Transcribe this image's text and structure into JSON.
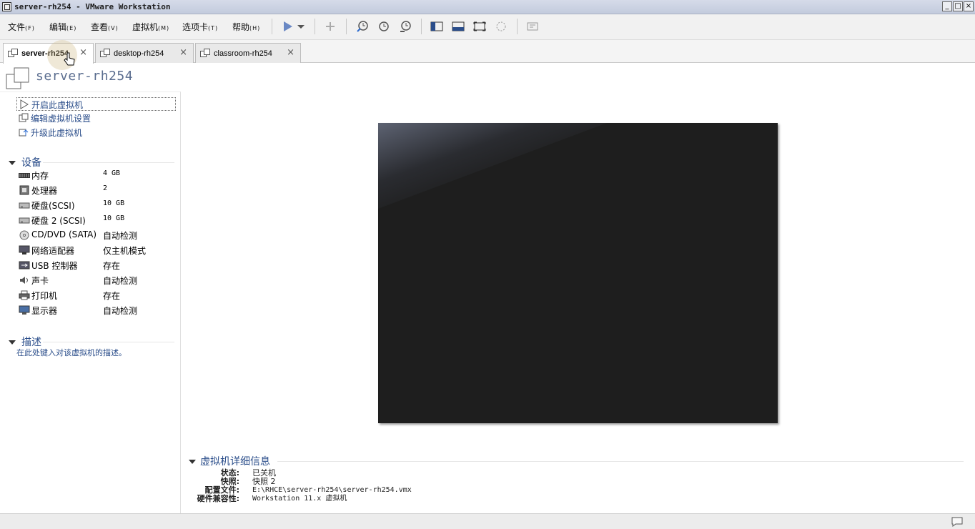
{
  "window": {
    "title": "server-rh254 - VMware Workstation",
    "controls": [
      "_",
      "□",
      "×"
    ]
  },
  "menu": [
    {
      "label": "文件",
      "key": "(F)"
    },
    {
      "label": "编辑",
      "key": "(E)"
    },
    {
      "label": "查看",
      "key": "(V)"
    },
    {
      "label": "虚拟机",
      "key": "(M)"
    },
    {
      "label": "选项卡",
      "key": "(T)"
    },
    {
      "label": "帮助",
      "key": "(H)"
    }
  ],
  "tabs": [
    {
      "label": "server-rh254",
      "close": "×"
    },
    {
      "label": "desktop-rh254",
      "close": "×"
    },
    {
      "label": "classroom-rh254",
      "close": "×"
    }
  ],
  "vm": {
    "name": "server-rh254"
  },
  "actions": [
    {
      "label": "开启此虚拟机",
      "icon": "play-icon"
    },
    {
      "label": "编辑虚拟机设置",
      "icon": "edit-settings-icon"
    },
    {
      "label": "升级此虚拟机",
      "icon": "upgrade-icon"
    }
  ],
  "devices_section": {
    "title": "设备"
  },
  "devices": [
    {
      "name": "内存",
      "value": "4 GB",
      "icon": "memory-icon"
    },
    {
      "name": "处理器",
      "value": "2",
      "icon": "cpu-icon"
    },
    {
      "name": "硬盘(SCSI)",
      "value": "10 GB",
      "icon": "harddisk-icon"
    },
    {
      "name": "硬盘 2 (SCSI)",
      "value": "10 GB",
      "icon": "harddisk-icon"
    },
    {
      "name": "CD/DVD (SATA)",
      "value": "自动检测",
      "icon": "cdrom-icon"
    },
    {
      "name": "网络适配器",
      "value": "仅主机模式",
      "icon": "network-icon"
    },
    {
      "name": "USB 控制器",
      "value": "存在",
      "icon": "usb-icon"
    },
    {
      "name": "声卡",
      "value": "自动检测",
      "icon": "sound-icon"
    },
    {
      "name": "打印机",
      "value": "存在",
      "icon": "printer-icon"
    },
    {
      "name": "显示器",
      "value": "自动检测",
      "icon": "display-icon"
    }
  ],
  "description_section": {
    "title": "描述",
    "placeholder": "在此处键入对该虚拟机的描述。"
  },
  "details": {
    "title": "虚拟机详细信息",
    "rows": [
      {
        "key": "状态:",
        "value": "已关机"
      },
      {
        "key": "快照:",
        "value": "快照 2"
      },
      {
        "key": "配置文件:",
        "value": "E:\\RHCE\\server-rh254\\server-rh254.vmx"
      },
      {
        "key": "硬件兼容性:",
        "value": "Workstation 11.x 虚拟机"
      }
    ]
  },
  "colors": {
    "accent_text": "#2a4d8a",
    "preview_bg": "#1e1e1e",
    "header_title": "#5a6d8f"
  }
}
